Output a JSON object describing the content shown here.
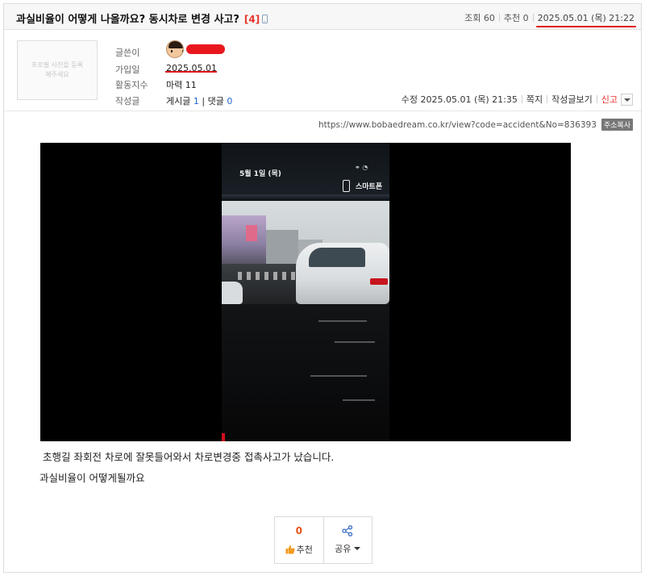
{
  "post": {
    "title": "과실비율이 어떻게 나올까요? 동시차로 변경 사고?",
    "comment_count": "[4]",
    "views": "조회 60",
    "recommends": "추천 0",
    "posted_at": "2025.05.01 (목) 21:22"
  },
  "profile": {
    "photo_placeholder": "프로필 사진을 등록해주세요",
    "labels": {
      "author": "글쓴이",
      "joined": "가입일",
      "activity": "활동지수",
      "posts": "작성글"
    },
    "joined_value": "2025.05.01",
    "activity_value": "마력 11",
    "posts_label": "게시글",
    "posts_count": "1",
    "comments_label": "댓글",
    "comments_count": "0"
  },
  "actions": {
    "edited": "수정 2025.05.01 (목) 21:35",
    "message": "쪽지",
    "view_posts": "작성글보기",
    "report": "신고"
  },
  "url": {
    "text": "https://www.bobaedream.co.kr/view?code=accident&No=836393",
    "copy_label": "주소복사"
  },
  "video": {
    "screen_date": "5월 1일 (목)",
    "screen_label": "스마트폰"
  },
  "body": {
    "line1": "초행길 좌회전  차로에 잘못들어와서 차로변경중 접촉사고가 났습니다.",
    "line2": "과실비율이 어떻게될까요"
  },
  "buttons": {
    "recommend_count": "0",
    "recommend_label": "추천",
    "share_label": "공유"
  },
  "colors": {
    "accent_red": "#e8332a",
    "link_blue": "#2266cc",
    "recommend_orange": "#e8531a"
  }
}
